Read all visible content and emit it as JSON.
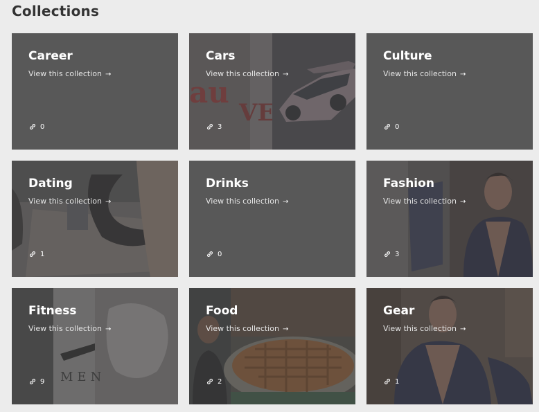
{
  "page": {
    "title": "Collections"
  },
  "collections": [
    {
      "name": "Career",
      "link_label": "View this collection",
      "count": "0"
    },
    {
      "name": "Cars",
      "link_label": "View this collection",
      "count": "3"
    },
    {
      "name": "Culture",
      "link_label": "View this collection",
      "count": "0"
    },
    {
      "name": "Dating",
      "link_label": "View this collection",
      "count": "1"
    },
    {
      "name": "Drinks",
      "link_label": "View this collection",
      "count": "0"
    },
    {
      "name": "Fashion",
      "link_label": "View this collection",
      "count": "3"
    },
    {
      "name": "Fitness",
      "link_label": "View this collection",
      "count": "9"
    },
    {
      "name": "Food",
      "link_label": "View this collection",
      "count": "2"
    },
    {
      "name": "Gear",
      "link_label": "View this collection",
      "count": "1"
    }
  ],
  "icons": {
    "arrow": "arrow-right-icon",
    "count": "link-icon"
  }
}
